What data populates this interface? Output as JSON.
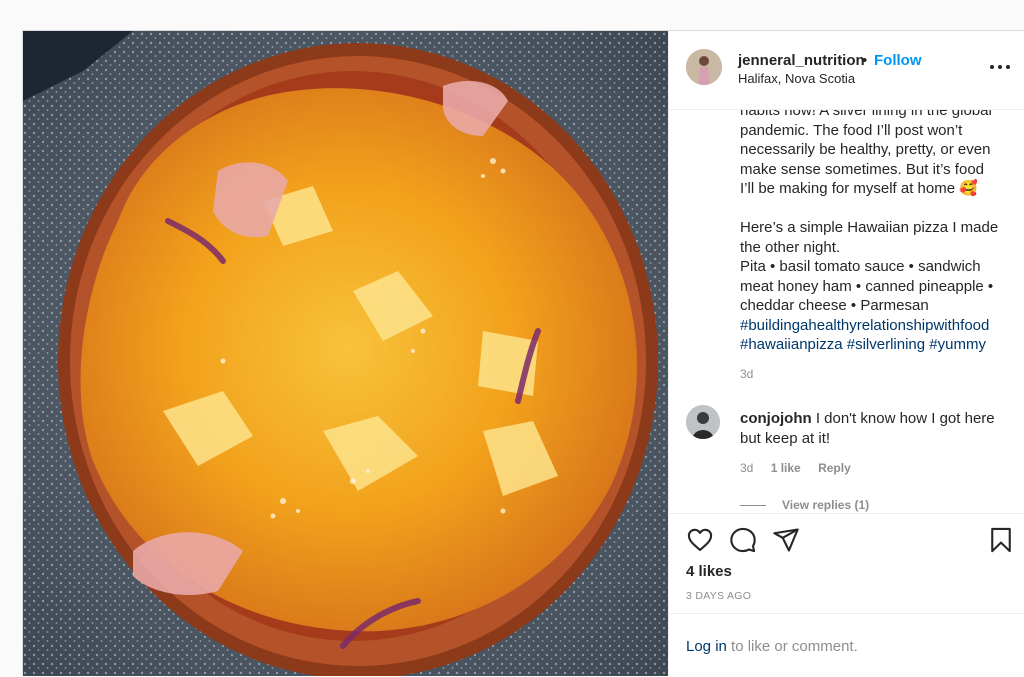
{
  "header": {
    "username": "jenneral_nutrition",
    "separator": "•",
    "follow_label": "Follow",
    "location": "Halifax, Nova Scotia",
    "more_icon": "more-horizontal-icon"
  },
  "caption": {
    "lines": [
      "habits now! A silver lining in the global",
      "pandemic. The food I’ll post won’t",
      "necessarily be healthy, pretty, or even",
      "make sense sometimes. But it’s food",
      "I’ll be making for myself at home 🥰"
    ],
    "body_lines": [
      "Here’s a simple Hawaiian pizza I made",
      "the other night.",
      "Pita • basil tomato sauce • sandwich",
      "meat honey ham • canned pineapple •",
      "cheddar cheese • Parmesan"
    ],
    "hashtags_line1": "#buildingahealthyrelationshipwithfood",
    "hashtags_line2": [
      "#hawaiianpizza",
      "#silverlining",
      "#yummy"
    ],
    "time": "3d"
  },
  "comment": {
    "username": "conjojohn",
    "text": " I don't know how I got here but keep at it!",
    "time": "3d",
    "likes": "1 like",
    "reply_label": "Reply",
    "view_replies": "View replies (1)"
  },
  "actions": {
    "icons": [
      "heart-icon",
      "comment-icon",
      "share-icon",
      "bookmark-icon"
    ],
    "likes_label": "4 likes",
    "posted_ago": "3 DAYS AGO"
  },
  "login": {
    "link_label": "Log in",
    "rest": " to like or comment."
  },
  "colors": {
    "link_blue": "#0095f6",
    "hashtag": "#00376b",
    "muted": "#8e8e8e",
    "border": "#efefef"
  }
}
